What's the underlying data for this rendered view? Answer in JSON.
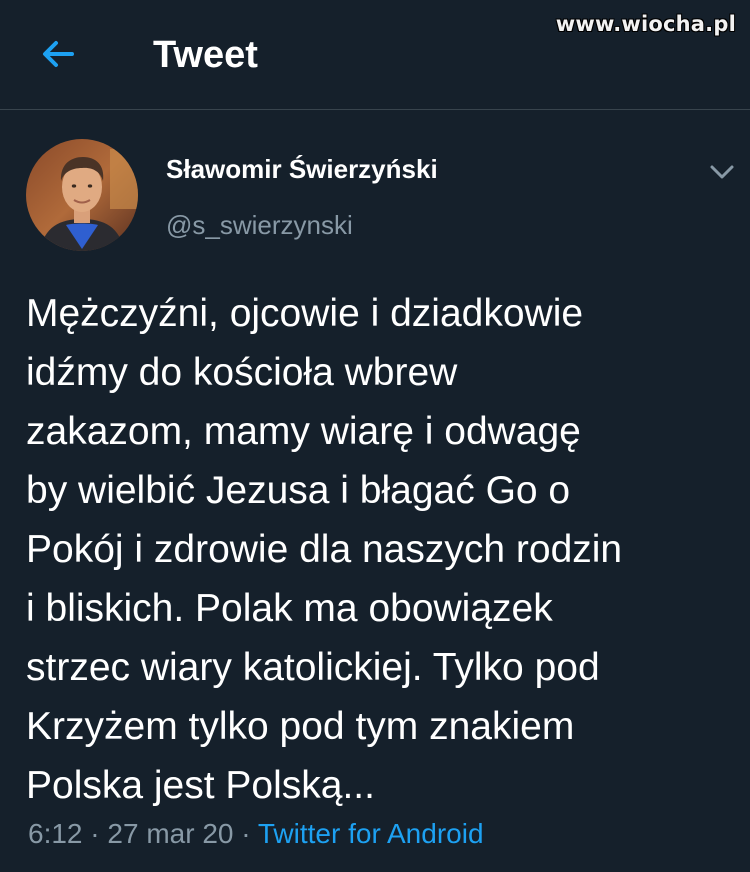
{
  "watermark": "www.wiocha.pl",
  "header": {
    "title": "Tweet",
    "back_icon": "arrow-left-icon"
  },
  "colors": {
    "background": "#15202b",
    "accent": "#1da1f2",
    "secondary_text": "#8899a6",
    "divider": "#38444d"
  },
  "tweet": {
    "author": {
      "display_name": "Sławomir Świerzyński",
      "handle": "@s_swierzynski"
    },
    "menu_icon": "chevron-down-icon",
    "text": "Mężczyźni, ojcowie i dziadkowie\nidźmy do kościoła wbrew\nzakazom, mamy wiarę i odwagę\nby wielbić Jezusa i błagać Go o\nPokój i zdrowie dla naszych rodzin\ni bliskich. Polak ma obowiązek\nstrzec wiary katolickiej. Tylko pod\nKrzyżem tylko pod tym znakiem\nPolska jest Polską...",
    "time": "6:12",
    "separator": " · ",
    "date": "27 mar 20",
    "source": "Twitter for Android"
  }
}
